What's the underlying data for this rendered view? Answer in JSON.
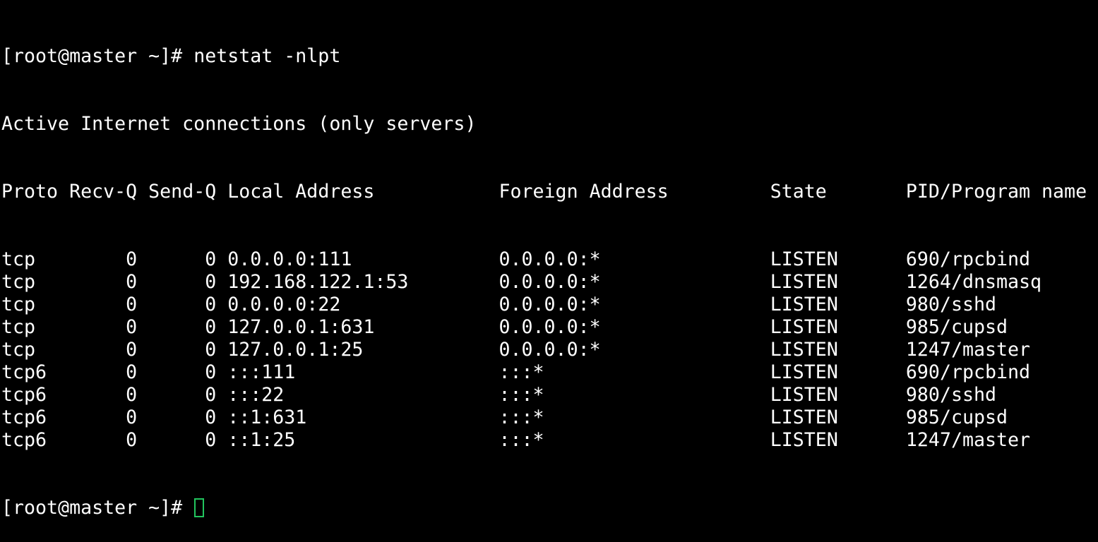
{
  "terminal": {
    "prompt": "[root@master ~]# ",
    "command": "netstat -nlpt",
    "output_header": "Active Internet connections (only servers)",
    "columns": [
      "Proto",
      "Recv-Q",
      "Send-Q",
      "Local Address",
      "Foreign Address",
      "State",
      "PID/Program name"
    ],
    "rows": [
      {
        "proto": "tcp",
        "recvq": "0",
        "sendq": "0",
        "local": "0.0.0.0:111",
        "foreign": "0.0.0.0:*",
        "state": "LISTEN",
        "pid": "690/rpcbind"
      },
      {
        "proto": "tcp",
        "recvq": "0",
        "sendq": "0",
        "local": "192.168.122.1:53",
        "foreign": "0.0.0.0:*",
        "state": "LISTEN",
        "pid": "1264/dnsmasq"
      },
      {
        "proto": "tcp",
        "recvq": "0",
        "sendq": "0",
        "local": "0.0.0.0:22",
        "foreign": "0.0.0.0:*",
        "state": "LISTEN",
        "pid": "980/sshd"
      },
      {
        "proto": "tcp",
        "recvq": "0",
        "sendq": "0",
        "local": "127.0.0.1:631",
        "foreign": "0.0.0.0:*",
        "state": "LISTEN",
        "pid": "985/cupsd"
      },
      {
        "proto": "tcp",
        "recvq": "0",
        "sendq": "0",
        "local": "127.0.0.1:25",
        "foreign": "0.0.0.0:*",
        "state": "LISTEN",
        "pid": "1247/master"
      },
      {
        "proto": "tcp6",
        "recvq": "0",
        "sendq": "0",
        "local": ":::111",
        "foreign": ":::*",
        "state": "LISTEN",
        "pid": "690/rpcbind"
      },
      {
        "proto": "tcp6",
        "recvq": "0",
        "sendq": "0",
        "local": ":::22",
        "foreign": ":::*",
        "state": "LISTEN",
        "pid": "980/sshd"
      },
      {
        "proto": "tcp6",
        "recvq": "0",
        "sendq": "0",
        "local": "::1:631",
        "foreign": ":::*",
        "state": "LISTEN",
        "pid": "985/cupsd"
      },
      {
        "proto": "tcp6",
        "recvq": "0",
        "sendq": "0",
        "local": "::1:25",
        "foreign": ":::*",
        "state": "LISTEN",
        "pid": "1247/master"
      }
    ],
    "cursor_color": "#22c55e",
    "background_color": "#000000",
    "text_color": "#ffffff"
  }
}
